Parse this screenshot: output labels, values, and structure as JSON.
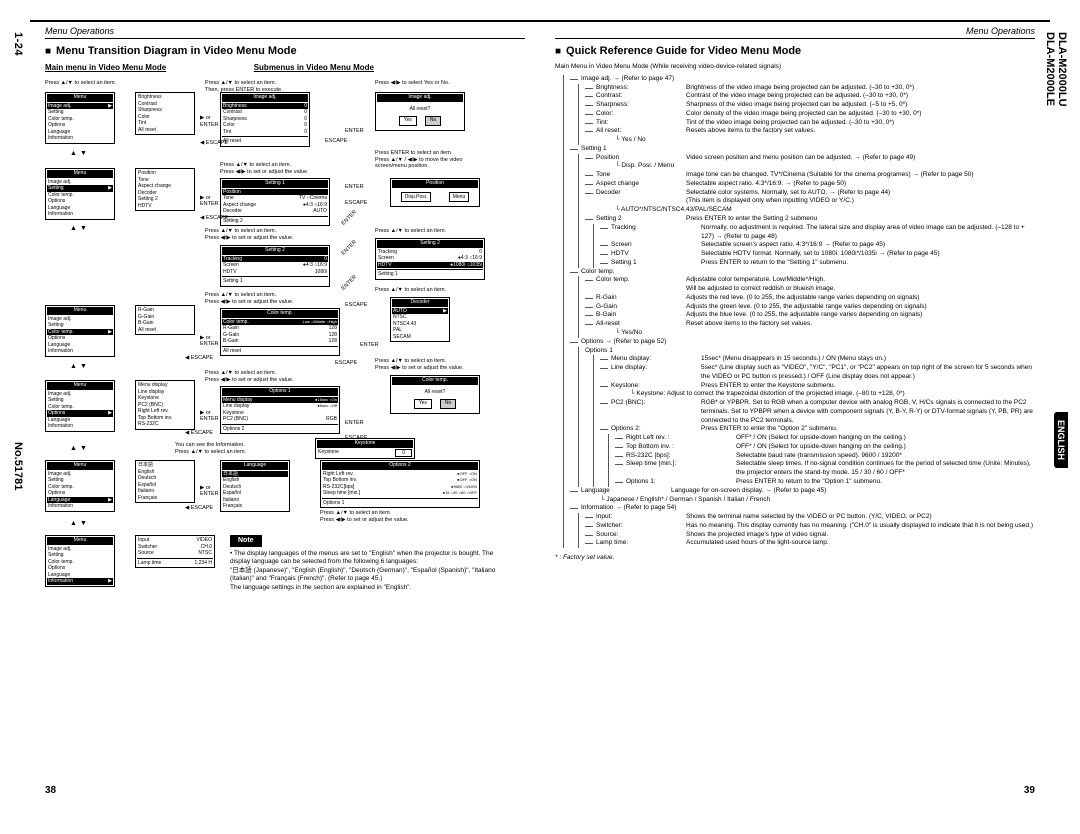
{
  "doc": {
    "spine_top": "1-24",
    "spine_mid": "No.51781",
    "right_spine": "DLA-M2000LU\nDLA-M2000LE",
    "english_tab": "ENGLISH",
    "page_left_num": "38",
    "page_right_num": "39"
  },
  "left": {
    "header": "Menu Operations",
    "title": "Menu Transition Diagram in Video Menu Mode",
    "sub_left": "Main menu in Video Menu Mode",
    "sub_right": "Submenus in Video Menu Mode",
    "instruction_select": "Press ▲/▼ to select an item.",
    "instruction_adjust": "Press ◀/▶ to set or adjust the value.",
    "instruction_then_enter": "Then, press ENTER to execute.",
    "instruction_yesno": "Press ◀/▶ to select Yes or No.",
    "instruction_enter_select": "Press ENTER to select an item.",
    "instruction_move": "Press ▲/▼ / ◀/▶ to move the video screen/menu position.",
    "instruction_info": "You can see the Information.",
    "main_menu_items": [
      "Image adj.",
      "Setting",
      "Color temp.",
      "Options",
      "Language",
      "Information"
    ],
    "image_adj_sub": [
      {
        "k": "Brightness",
        "v": "0"
      },
      {
        "k": "Contrast",
        "v": "0"
      },
      {
        "k": "Sharpness",
        "v": "0"
      },
      {
        "k": "Color",
        "v": "0"
      },
      {
        "k": "Tint",
        "v": "0"
      },
      {
        "k": "All reset",
        "v": ""
      }
    ],
    "image_adj_detail": [
      {
        "k": "Brightness",
        "v": "0"
      },
      {
        "k": "Contrast",
        "v": "0"
      },
      {
        "k": "Sharpness",
        "v": "0"
      },
      {
        "k": "Color",
        "v": "0"
      },
      {
        "k": "Tint",
        "v": "0"
      },
      {
        "k": "All reset",
        "v": ""
      }
    ],
    "all_reset_box": {
      "title": "Image adj.",
      "text": "All reset?",
      "yes": "Yes",
      "no": "No"
    },
    "setting1_items": [
      {
        "k": "Position",
        "v": ""
      },
      {
        "k": "Tone",
        "v": "TV  ○Cinema"
      },
      {
        "k": "Aspect change",
        "v": "●4:3  ○16:9"
      },
      {
        "k": "Decoder",
        "v": "AUTO"
      },
      {
        "k": "Setting 2",
        "v": ""
      }
    ],
    "position_box": {
      "title": "Position",
      "disp": "Disp.Posi.",
      "menu": "Menu"
    },
    "setting2_items": [
      {
        "k": "Tracking",
        "v": "0"
      },
      {
        "k": "Screen",
        "v": "●4:3  ○16:9"
      },
      {
        "k": "HDTV",
        "v": "1080i"
      },
      {
        "k": "Setting 1",
        "v": ""
      }
    ],
    "tracking_detail": [
      {
        "k": "Tracking",
        "v": "0"
      },
      {
        "k": "Screen",
        "v": "●4:3 ○16:9"
      },
      {
        "k": "HDTV",
        "v": "●1080i ○1035i"
      },
      {
        "k": "Setting 1",
        "v": ""
      }
    ],
    "decoder_box": {
      "title": "Decoder",
      "items": [
        "AUTO",
        "NTSC",
        "NTSC4.43",
        "PAL",
        "SECAM"
      ]
    },
    "color_temp_items": [
      {
        "k": "Color temp.",
        "v": "Low  ○Middle  ○High"
      },
      {
        "k": "R-Gain",
        "v": "128"
      },
      {
        "k": "G-Gain",
        "v": "128"
      },
      {
        "k": "B-Gain",
        "v": "128"
      },
      {
        "k": "All reset",
        "v": ""
      }
    ],
    "ct_all_reset_box": {
      "title": "Color temp.",
      "text": "All reset?",
      "yes": "Yes",
      "no": "No"
    },
    "options1_items": [
      {
        "k": "Menu display",
        "v": "●15sec ○On"
      },
      {
        "k": "Line display",
        "v": "●5sec ○Off"
      },
      {
        "k": "Keystone",
        "v": ""
      },
      {
        "k": "PC2 (BNC)",
        "v": "RGB"
      },
      {
        "k": "Options 2",
        "v": ""
      }
    ],
    "keystone_box": {
      "title": "Keystone",
      "k": "Keystone",
      "v": "0"
    },
    "options2_items": [
      {
        "k": "Right Left rev.",
        "v": "●OFF ○ON"
      },
      {
        "k": "Top Bottom inv.",
        "v": "●OFF ○ON"
      },
      {
        "k": "RS-232C[bps]",
        "v": "●9600 ○19200"
      },
      {
        "k": "Sleep time [min.]",
        "v": "●15 ○30 ○60 ○OFF"
      },
      {
        "k": "Options 1",
        "v": ""
      }
    ],
    "language_items": [
      "日本語",
      "English",
      "Deutsch",
      "Español",
      "Italiano",
      "Français"
    ],
    "information_items": [
      {
        "k": "Input",
        "v": "VIDEO"
      },
      {
        "k": "Switcher",
        "v": "CH.0"
      },
      {
        "k": "Source",
        "v": "NTSC"
      },
      {
        "k": "Lamp time",
        "v": "1,234 H"
      }
    ],
    "nav_labels": {
      "enter": "ENTER",
      "escape": "ESCAPE",
      "or": "or"
    },
    "note_label": "Note",
    "note_text": "• The display languages of the menus are set to \"English\" when the projector is bought. The display language can be selected from the following 6 languages:\n\"日本語 (Japanese)\", \"English (English)\", \"Deutsch (German)\", \"Español (Spanish)\", \"Italiano (Italian)\" and \"Français (French)\". (Refer to page 45.)\nThe language settings in the section are explained in \"English\"."
  },
  "right": {
    "header": "Menu Operations",
    "title": "Quick Reference Guide for Video Menu Mode",
    "intro": "Main Menu in Video Menu Mode (While receiving video-device-related signals)",
    "tree": {
      "image_adj": {
        "head": "Image adj. → (Refer to page 47)",
        "items": [
          {
            "k": "Brightness:",
            "d": "Brightness of the video image being projected can be adjusted. (–30 to +30, 0*)"
          },
          {
            "k": "Contrast:",
            "d": "Contrast of the video image being projected can be adjusted. (–30 to +30, 0*)"
          },
          {
            "k": "Sharpness:",
            "d": "Sharpness of the video image being projected can be adjusted. (–5 to +5, 0*)"
          },
          {
            "k": "Color:",
            "d": "Color density of the video image being projected can be adjusted. (–30 to +30, 0*)"
          },
          {
            "k": "Tint:",
            "d": "Tint of the video image being projected can be adjusted. (–30 to +30, 0*)"
          },
          {
            "k": "All reset:",
            "d": "Resets above items to the factory set values."
          }
        ],
        "tail": "└ Yes / No"
      },
      "setting1": {
        "head": "Setting 1",
        "items": [
          {
            "k": "Position",
            "d": "Video screen position and menu position can be adjusted. → (Refer to page 49)",
            "tail": "└ Disp. Posi. / Menu"
          },
          {
            "k": "Tone",
            "d": "Image tone can be changed. TV*/Cinema (Suitable for the cinema programes) → (Refer to page 50)"
          },
          {
            "k": "Aspect change",
            "d": "Selectable aspect ratio. 4:3*/16:9. → (Refer to page 50)"
          },
          {
            "k": "Decoder",
            "d": "Selectable color systems. Normally, set to AUTO. → (Refer to page 44)\n(This item is displayed only when inputting VIDEO or Y/C.)",
            "tail": "└ AUTO*/NTSC/NTSC4.43/PAL/SECAM"
          },
          {
            "k": "Setting 2",
            "d": "Press ENTER to enter the Setting 2 submenu"
          }
        ],
        "s2": [
          {
            "k": "Tracking",
            "d": "Normally, no adjustment is required. The lateral size and display area of video image can be adjusted. (–128 to + 127) → (Refer to page 48)"
          },
          {
            "k": "Screen",
            "d": "Selectable screen's aspect ratio. 4:3*/16:9 → (Refer to page 45)"
          },
          {
            "k": "HDTV",
            "d": "Selectable HDTV format. Normally, set to 1080i. 1080i*/1035i → (Refer to page 45)"
          },
          {
            "k": "Setting 1",
            "d": "Press ENTER to return to the \"Setting 1\" submenu."
          }
        ]
      },
      "color_temp": {
        "head": "Color temp.",
        "items": [
          {
            "k": "Color temp.",
            "d": "Adjustable color temperature. Low/Middle*/High.\nWill be adjusted to correct reddish or blueish image."
          },
          {
            "k": "R-Gain",
            "d": "Adjusts the red leve. (0 to 255, the adjustable range varies depending on signals)"
          },
          {
            "k": "G-Gain",
            "d": "Adjusts the green leve. (0 to 255, the adjustable range varies depending on signals)"
          },
          {
            "k": "B-Gain",
            "d": "Adjusts the blue leve. (0 to 255, the adjustable range varies depending on signals)"
          },
          {
            "k": "All-reset",
            "d": "Reset above items to the factory set values.",
            "tail": "└ Yes/No"
          }
        ]
      },
      "options": {
        "head": "Options → (Refer to page 52)",
        "o1_head": "Options 1",
        "o1": [
          {
            "k": "Menu display:",
            "d": "15sec* (Menu disappears in 15 seconds.) / ON (Menu stays on.)"
          },
          {
            "k": "Line display:",
            "d": "5sec* (Line display such as \"VIDEO\", \"Y/C\", \"PC1\", or \"PC2\" appears on top right of the screen for 5 seconds when the VIDEO or PC button is pressed.) / OFF (Line display does not appear.)"
          },
          {
            "k": "Keystone:",
            "d": "Press ENTER to enter the Keystone submenu.",
            "tail": "└ Keystone:        Adjust to correct the trapezoidal distortion of the projected image. (–80 to +128, 0*)"
          },
          {
            "k": "PC2 (BNC):",
            "d": "RGB* or YPBPR. Set to RGB when a computer device with analog RGB, V, H/Cs signals is connected to the PC2 terminals. Set to YPBPR when a device with component signals (Y, B-Y, R-Y) or DTV-format signals (Y, PB, PR) are connected to the PC2 terminals."
          },
          {
            "k": "Options 2:",
            "d": "Press ENTER to enter the \"Option 2\" submenu."
          }
        ],
        "o2": [
          {
            "k": "Right Left rev. :",
            "d": "OFF* / ON (Select for upside-down hanging on the ceiling.)"
          },
          {
            "k": "Top Bottom inv. :",
            "d": "OFF* / ON (Select for upside-down hanging on the ceiling.)"
          },
          {
            "k": "RS-232C [bps]:",
            "d": "Selectable baud rate (transmission speed). 9600 / 19200*"
          },
          {
            "k": "Sleep time [min.]:",
            "d": "Selectable sleep times. If no-signal condition continues for the period of selected time (Unite: Minutes), the projector enters the stand-by mode. 15 / 30 / 60 / OFF*"
          },
          {
            "k": "Options 1:",
            "d": "Press ENTER to return to the \"Option 1\" submenu."
          }
        ]
      },
      "language": {
        "head": "Language",
        "d": "Language for on-screen display. → (Refer to page 45)",
        "tail": "└ Japanese / English* / German / Spanish / Italian / French"
      },
      "information": {
        "head": "Information → (Refer to page 54)",
        "items": [
          {
            "k": "Input:",
            "d": "Shows the terminal name selected by the VIDEO or PC button. (Y/C, VIDEO, or PC2)"
          },
          {
            "k": "Switcher:",
            "d": "Has no meaning. This display currently has no meaning. (\"CH.0\" is usually displayed to indicate that it is not being used.)"
          },
          {
            "k": "Source:",
            "d": "Shows the projected image's type of video signal."
          },
          {
            "k": "Lamp time:",
            "d": "Accumulated used hours of the light-source lamp."
          }
        ]
      }
    },
    "factory": "* : Factory set value."
  }
}
